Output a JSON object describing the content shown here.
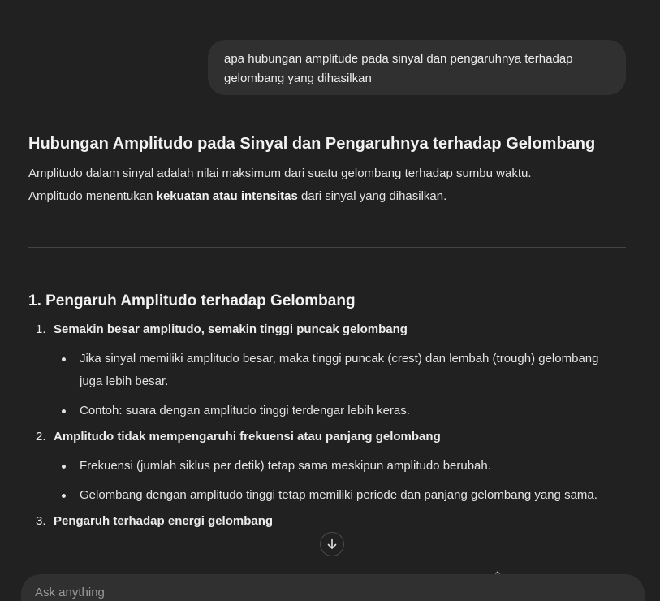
{
  "conversation": {
    "user_message": "apa hubungan amplitude pada sinyal dan pengaruhnya terhadap gelombang yang dihasilkan",
    "answer": {
      "title": "Hubungan Amplitudo pada Sinyal dan Pengaruhnya terhadap Gelombang",
      "intro_line1": "Amplitudo dalam sinyal adalah nilai maksimum dari suatu gelombang terhadap sumbu waktu.",
      "intro_line2_start": "Amplitudo menentukan ",
      "intro_line2_bold": "kekuatan atau intensitas",
      "intro_line2_end": " dari sinyal yang dihasilkan.",
      "section1_title": "1. Pengaruh Amplitudo terhadap Gelombang",
      "items": [
        {
          "number": "1.",
          "heading": "Semakin besar amplitudo, semakin tinggi puncak gelombang",
          "bullets": [
            "Jika sinyal memiliki amplitudo besar, maka tinggi puncak (crest) dan lembah (trough) gelombang juga lebih besar.",
            "Contoh: suara dengan amplitudo tinggi terdengar lebih keras."
          ]
        },
        {
          "number": "2.",
          "heading": "Amplitudo tidak mempengaruhi frekuensi atau panjang gelombang",
          "bullets": [
            "Frekuensi (jumlah siklus per detik) tetap sama meskipun amplitudo berubah.",
            "Gelombang dengan amplitudo tinggi tetap memiliki periode dan panjang gelombang yang sama."
          ]
        },
        {
          "number": "3.",
          "heading": "Pengaruh terhadap energi gelombang",
          "bullets": []
        }
      ]
    }
  },
  "composer": {
    "placeholder": "Ask anything"
  },
  "icons": {
    "scroll_down": "arrow-down-icon"
  },
  "colors": {
    "background": "#212121",
    "bubble": "#303030",
    "text": "#ececec"
  }
}
